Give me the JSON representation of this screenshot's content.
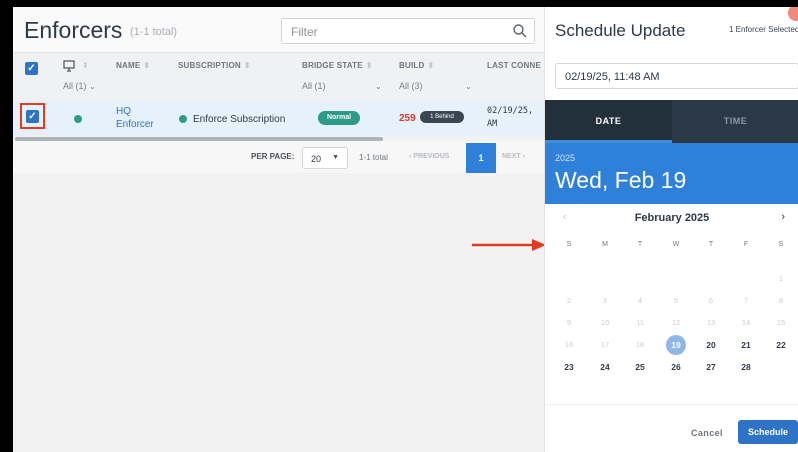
{
  "enforcers": {
    "title": "Enforcers",
    "count": "(1-1 total)",
    "filter_placeholder": "Filter",
    "columns": {
      "name": "NAME",
      "subscription": "SUBSCRIPTION",
      "bridge_state": "BRIDGE STATE",
      "build": "BUILD",
      "last_connected": "LAST CONNE"
    },
    "filters": {
      "device": "All (1)",
      "bridge_state": "All (1)",
      "build": "All (3)"
    },
    "row": {
      "name_line1": "HQ",
      "name_line2": "Enforcer",
      "subscription": "Enforce Subscription",
      "bridge_state": "Normal",
      "build": "259",
      "behind": "1 Behind",
      "last_connected_line1": "02/19/25,",
      "last_connected_line2": "AM"
    },
    "pagination": {
      "per_page_label": "PER PAGE:",
      "per_page_value": "20",
      "total": "1-1 total",
      "previous": "PREVIOUS",
      "page": "1",
      "next": "NEXT"
    }
  },
  "schedule": {
    "title": "Schedule Update",
    "selected_count": "1 Enforcer Selected",
    "datetime_value": "02/19/25, 11:48 AM",
    "tabs": {
      "date": "DATE",
      "time": "TIME"
    },
    "year": "2025",
    "date_display": "Wed, Feb 19",
    "month": "February 2025",
    "weekdays": [
      "S",
      "M",
      "T",
      "W",
      "T",
      "F",
      "S"
    ],
    "weeks": [
      [
        "",
        "",
        "",
        "",
        "",
        "",
        "1"
      ],
      [
        "2",
        "3",
        "4",
        "5",
        "6",
        "7",
        "8"
      ],
      [
        "9",
        "10",
        "11",
        "12",
        "13",
        "14",
        "15"
      ],
      [
        "16",
        "17",
        "18",
        "19",
        "20",
        "21",
        "22"
      ],
      [
        "23",
        "24",
        "25",
        "26",
        "27",
        "28",
        ""
      ]
    ],
    "first_enabled_day": 19,
    "selected_day": 19,
    "cancel_label": "Cancel",
    "schedule_label": "Schedule"
  },
  "colors": {
    "primary": "#2f80d8",
    "status_green": "#2e9b8a",
    "alert_red": "#e23a25",
    "dark_header": "#22303c"
  }
}
